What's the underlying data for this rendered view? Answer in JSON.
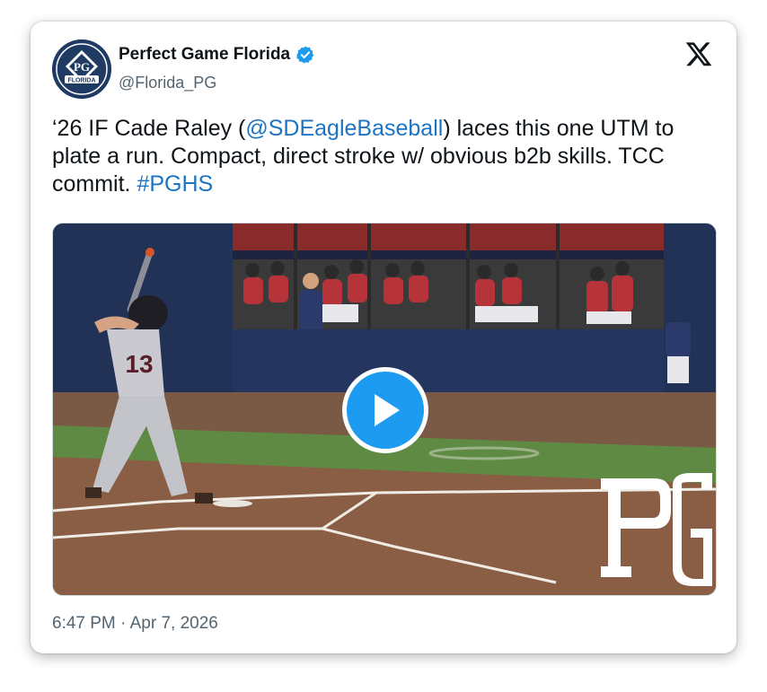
{
  "account": {
    "display_name": "Perfect Game Florida",
    "handle": "@Florida_PG",
    "avatar_text": "FLORIDA",
    "avatar_monogram": "PG",
    "verified": true
  },
  "tweet": {
    "text_part1": "‘26 IF Cade Raley (",
    "mention": "@SDEagleBaseball",
    "text_part2": ") laces this one UTM to plate a run. Compact, direct stroke w/ obvious b2b skills. TCC commit. ",
    "hashtag": "#PGHS",
    "timestamp": "6:47 PM · Apr 7, 2026"
  },
  "media": {
    "type": "video",
    "jersey_number": "13",
    "watermark": "PG"
  },
  "icons": {
    "logo": "x-logo-icon",
    "verified": "verified-badge-icon",
    "play": "play-icon"
  },
  "colors": {
    "link": "#1d74c4",
    "verified": "#1d9bf0",
    "play_button": "#1d9bf0",
    "avatar_bg": "#1f3a63"
  }
}
